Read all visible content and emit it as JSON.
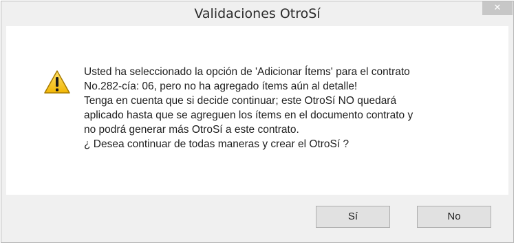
{
  "dialog": {
    "title": "Validaciones OtroSí",
    "close_label": "✕",
    "message_lines": [
      "Usted ha seleccionado la opción de 'Adicionar Ítems' para el contrato",
      "No.282-cía: 06, pero no ha agregado ítems aún al detalle!",
      "Tenga en cuenta que si decide continuar; este OtroSí NO quedará",
      "aplicado hasta que se agreguen los ítems en el documento contrato y",
      "no podrá generar más OtroSí a este contrato.",
      "¿ Desea continuar de todas maneras y crear el OtroSí ?"
    ],
    "buttons": {
      "yes": "Sí",
      "no": "No"
    },
    "icon": "warning-icon"
  },
  "colors": {
    "warning_yellow": "#f5c518",
    "warning_outline": "#8a6d00",
    "close_button_bg": "#c7c7c7"
  }
}
